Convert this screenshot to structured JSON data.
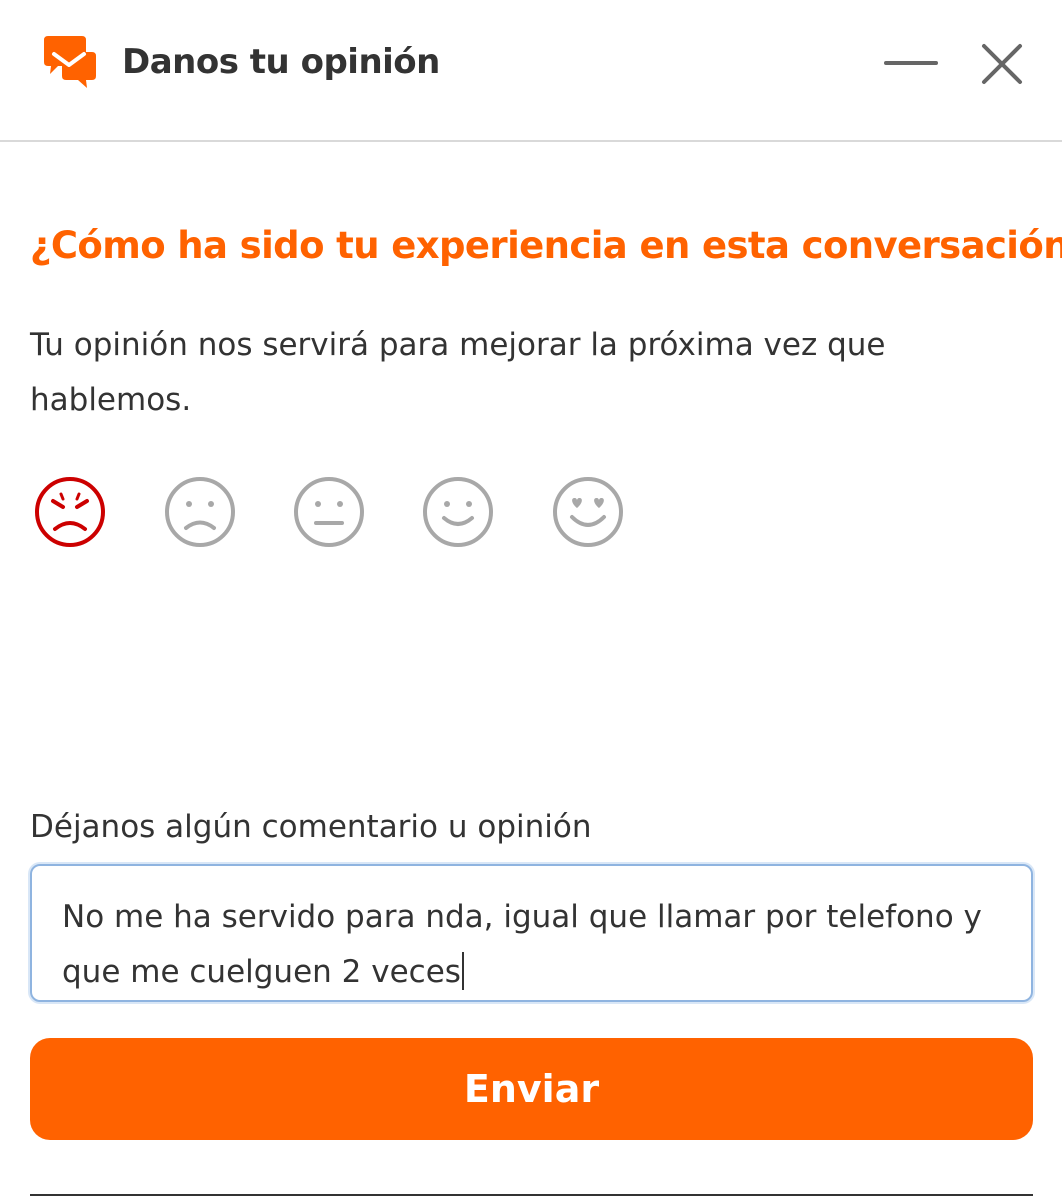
{
  "colors": {
    "accent": "#ff6200",
    "selected_rating": "#cc0000",
    "unselected_rating": "#a8a8a8",
    "text": "#333333",
    "input_focus_border": "#8fb4e0"
  },
  "header": {
    "title": "Danos tu opinión",
    "logo_icon": "chat-bubbles-icon",
    "minimize_icon": "minimize-icon",
    "close_icon": "close-icon"
  },
  "survey": {
    "question": "¿Cómo ha sido tu experiencia en esta conversación?",
    "subtitle": "Tu opinión nos servirá para mejorar la próxima vez que hablemos.",
    "ratings": [
      {
        "icon": "angry-face-icon",
        "selected": true
      },
      {
        "icon": "sad-face-icon",
        "selected": false
      },
      {
        "icon": "neutral-face-icon",
        "selected": false
      },
      {
        "icon": "smile-face-icon",
        "selected": false
      },
      {
        "icon": "love-face-icon",
        "selected": false
      }
    ],
    "comment_label": "Déjanos algún comentario u opinión",
    "comment_value": "No me ha servido para nda, igual que llamar por telefono y que me cuelguen 2 veces",
    "submit_label": "Enviar"
  }
}
